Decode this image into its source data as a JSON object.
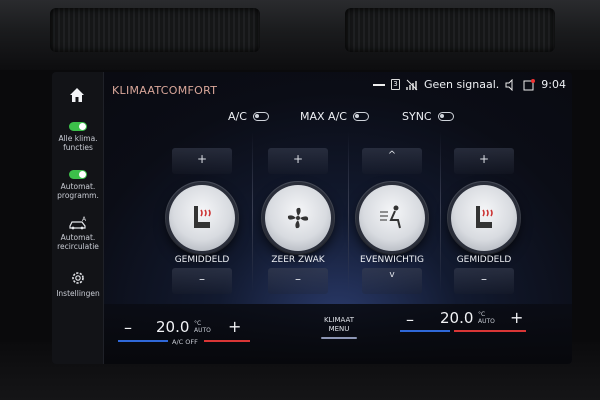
{
  "header": {
    "title": "KLIMAATCOMFORT",
    "sim_badge": "3",
    "signal_text": "Geen signaal.",
    "time": "9:04"
  },
  "sidebar": {
    "items": [
      {
        "label_line1": "Alle klima.",
        "label_line2": "functies"
      },
      {
        "label_line1": "Automat.",
        "label_line2": "programm."
      },
      {
        "label_line1": "Automat.",
        "label_line2": "recirculatie"
      },
      {
        "label_line1": "Instellingen",
        "label_line2": ""
      }
    ]
  },
  "toggles": {
    "ac": "A/C",
    "max_ac": "MAX A/C",
    "sync": "SYNC"
  },
  "dials": {
    "seat_left": {
      "plus": "+",
      "minus": "–",
      "label": "GEMIDDELD"
    },
    "fan": {
      "plus": "+",
      "minus": "–",
      "label": "ZEER ZWAK"
    },
    "distribution": {
      "up": "^",
      "down": "v",
      "label": "EVENWICHTIG"
    },
    "seat_right": {
      "plus": "+",
      "minus": "–",
      "label": "GEMIDDELD"
    }
  },
  "bottom": {
    "left_minus": "–",
    "left_temp": "20.0",
    "left_unit_line1": "°C",
    "left_unit_line2": "AUTO",
    "left_plus": "+",
    "ac_off": "A/C OFF",
    "menu_line1": "KLIMAAT",
    "menu_line2": "MENU",
    "right_minus": "–",
    "right_temp": "20.0",
    "right_unit_line1": "°C",
    "right_unit_line2": "AUTO",
    "right_plus": "+"
  },
  "colors": {
    "accent_title": "#d9a79a",
    "toggle_on": "#3cbf4a",
    "heat_red": "#d93636",
    "cool_blue": "#2f68d8"
  }
}
